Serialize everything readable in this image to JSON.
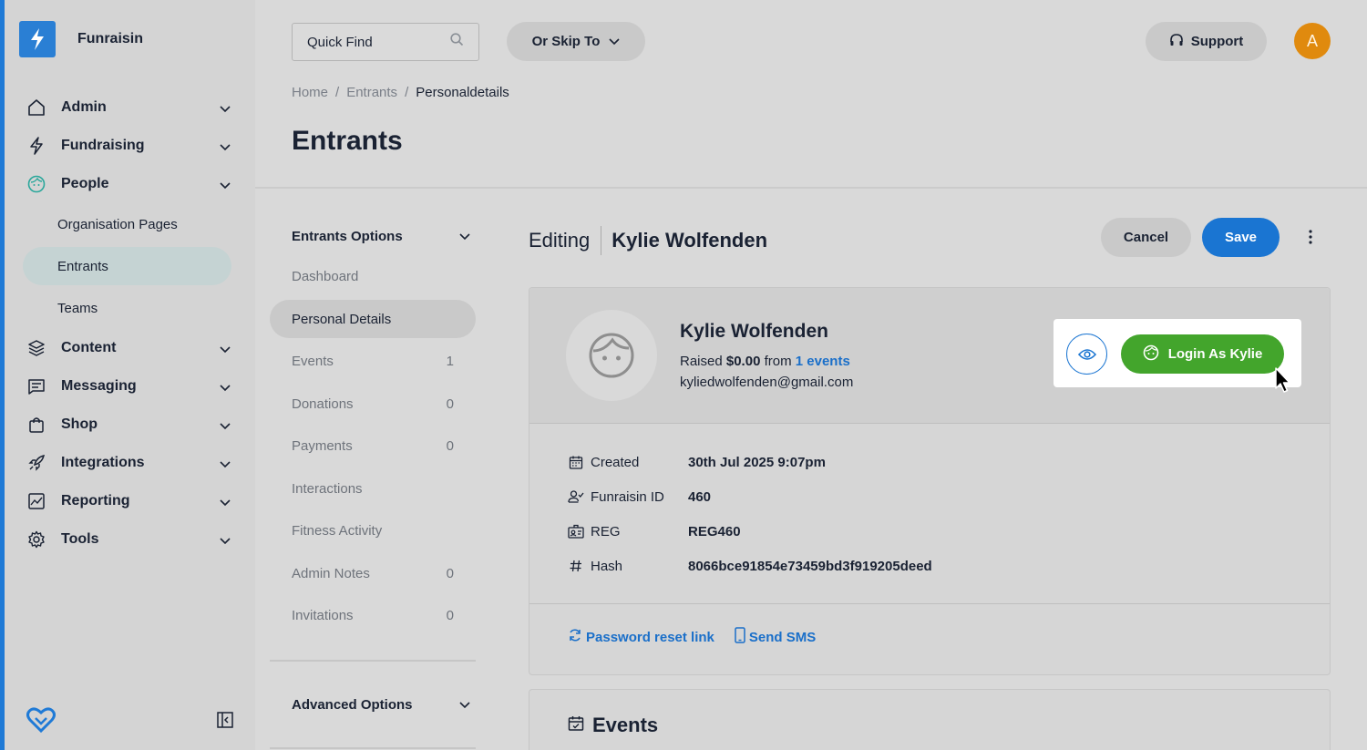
{
  "brand": {
    "name": "Funraisin"
  },
  "sidebar": {
    "items": [
      {
        "label": "Admin",
        "icon": "home-icon"
      },
      {
        "label": "Fundraising",
        "icon": "bolt-icon"
      },
      {
        "label": "People",
        "icon": "face-icon"
      },
      {
        "label": "Content",
        "icon": "layers-icon"
      },
      {
        "label": "Messaging",
        "icon": "message-icon"
      },
      {
        "label": "Shop",
        "icon": "bag-icon"
      },
      {
        "label": "Integrations",
        "icon": "rocket-icon"
      },
      {
        "label": "Reporting",
        "icon": "chart-icon"
      },
      {
        "label": "Tools",
        "icon": "gear-icon"
      }
    ],
    "people_sub": [
      "Organisation Pages",
      "Entrants",
      "Teams"
    ],
    "active_sub": "Entrants"
  },
  "topbar": {
    "search_placeholder": "Quick Find",
    "skip_label": "Or Skip To",
    "support_label": "Support",
    "avatar_initial": "A",
    "avatar_color": "#e08a0e"
  },
  "breadcrumb": {
    "home": "Home",
    "sep1": "/",
    "entrants": "Entrants",
    "sep2": "/",
    "current": "Personaldetails"
  },
  "page_title": "Entrants",
  "options": {
    "title": "Entrants Options",
    "items": [
      {
        "label": "Dashboard",
        "count": ""
      },
      {
        "label": "Personal Details",
        "count": ""
      },
      {
        "label": "Events",
        "count": "1"
      },
      {
        "label": "Donations",
        "count": "0"
      },
      {
        "label": "Payments",
        "count": "0"
      },
      {
        "label": "Interactions",
        "count": ""
      },
      {
        "label": "Fitness Activity",
        "count": ""
      },
      {
        "label": "Admin Notes",
        "count": "0"
      },
      {
        "label": "Invitations",
        "count": "0"
      }
    ],
    "active": "Personal Details",
    "advanced_title": "Advanced Options"
  },
  "editing": {
    "prefix": "Editing",
    "name": "Kylie Wolfenden",
    "cancel_label": "Cancel",
    "save_label": "Save"
  },
  "profile": {
    "name": "Kylie Wolfenden",
    "raised_prefix": "Raised",
    "raised_amount": "$0.00",
    "raised_from": "from",
    "events_link": "1 events",
    "email": "kyliedwolfenden@gmail.com",
    "login_label": "Login As Kylie"
  },
  "details": [
    {
      "label": "Created",
      "value": "30th Jul 2025 9:07pm",
      "icon": "calendar-icon"
    },
    {
      "label": "Funraisin ID",
      "value": "460",
      "icon": "user-check-icon"
    },
    {
      "label": "REG",
      "value": "REG460",
      "icon": "id-card-icon"
    },
    {
      "label": "Hash",
      "value": "8066bce91854e73459bd3f919205deed",
      "icon": "hash-icon"
    }
  ],
  "actions": {
    "password_reset": "Password reset link",
    "send_sms": "Send SMS"
  },
  "events_section": {
    "title": "Events"
  },
  "colors": {
    "accent": "#1a75d2",
    "success": "#43a52c",
    "sidebar_border": "#1f7ad6"
  }
}
